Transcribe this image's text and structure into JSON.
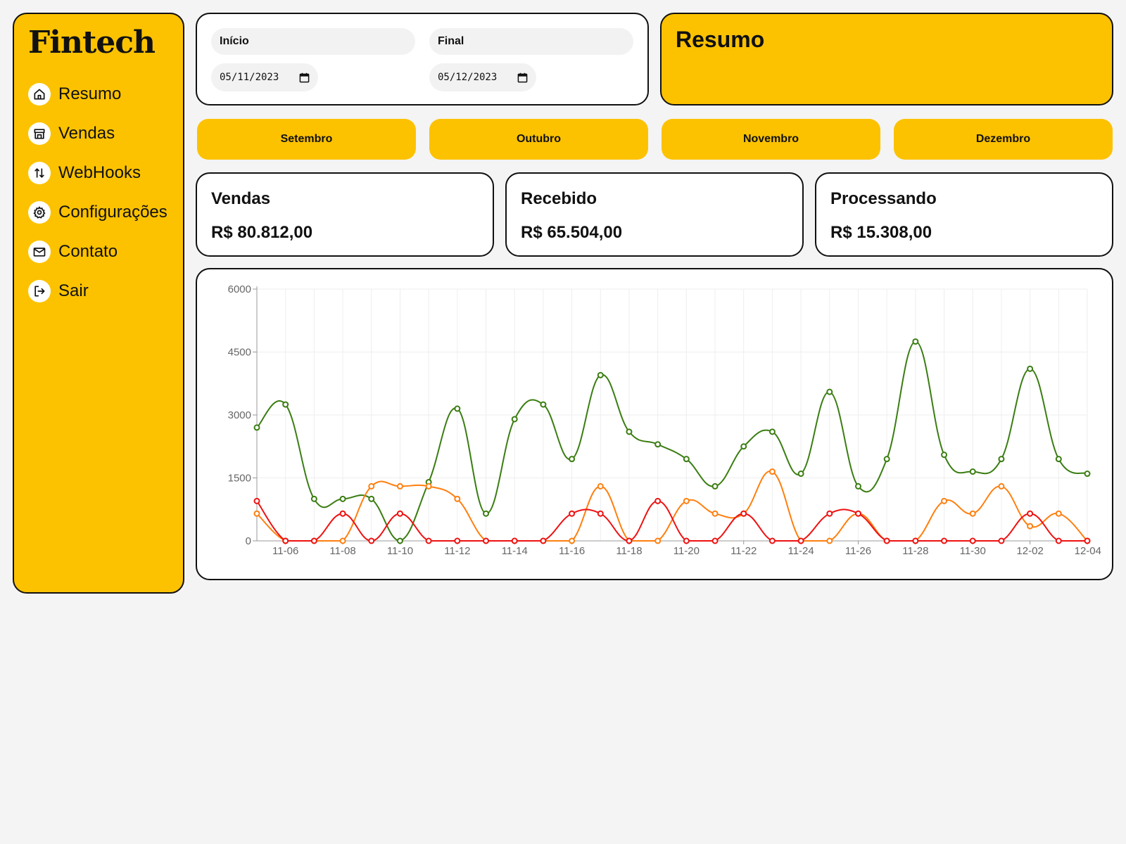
{
  "sidebar": {
    "logo": "Fintech",
    "items": [
      {
        "label": "Resumo",
        "icon": "home-icon"
      },
      {
        "label": "Vendas",
        "icon": "store-icon"
      },
      {
        "label": "WebHooks",
        "icon": "arrows-up-down-icon"
      },
      {
        "label": "Configurações",
        "icon": "gear-icon"
      },
      {
        "label": "Contato",
        "icon": "mail-icon"
      },
      {
        "label": "Sair",
        "icon": "logout-icon"
      }
    ]
  },
  "filters": {
    "start_label": "Início",
    "start_value": "05/11/2023",
    "end_label": "Final",
    "end_value": "05/12/2023"
  },
  "resumo": {
    "title": "Resumo"
  },
  "months": [
    "Setembro",
    "Outubro",
    "Novembro",
    "Dezembro"
  ],
  "metrics": [
    {
      "title": "Vendas",
      "value": "R$ 80.812,00"
    },
    {
      "title": "Recebido",
      "value": "R$ 65.504,00"
    },
    {
      "title": "Processando",
      "value": "R$ 15.308,00"
    }
  ],
  "colors": {
    "accent": "#fcc200",
    "series_green": "#3a7d12",
    "series_orange": "#ff7f0e",
    "series_red": "#ee1111"
  },
  "chart_data": {
    "type": "line",
    "title": "",
    "xlabel": "",
    "ylabel": "",
    "ylim": [
      0,
      6000
    ],
    "yticks": [
      0,
      1500,
      3000,
      4500,
      6000
    ],
    "x": [
      "11-05",
      "11-06",
      "11-07",
      "11-08",
      "11-09",
      "11-10",
      "11-11",
      "11-12",
      "11-13",
      "11-14",
      "11-15",
      "11-16",
      "11-17",
      "11-18",
      "11-19",
      "11-20",
      "11-21",
      "11-22",
      "11-23",
      "11-24",
      "11-25",
      "11-26",
      "11-27",
      "11-28",
      "11-29",
      "11-30",
      "12-01",
      "12-02",
      "12-03",
      "12-04"
    ],
    "xtick_labels": [
      "11-06",
      "11-08",
      "11-10",
      "11-12",
      "11-14",
      "11-16",
      "11-18",
      "11-20",
      "11-22",
      "11-24",
      "11-26",
      "11-28",
      "11-30",
      "12-02",
      "12-04"
    ],
    "grid": true,
    "legend": "none",
    "series": [
      {
        "color": "#3a7d12",
        "values": [
          2700,
          3250,
          1000,
          1000,
          1000,
          0,
          1400,
          3150,
          650,
          2900,
          3250,
          1950,
          3950,
          2600,
          2300,
          1950,
          1300,
          2250,
          2600,
          1600,
          3550,
          1300,
          1950,
          4750,
          2050,
          1650,
          1950,
          4100,
          1950,
          1600
        ]
      },
      {
        "color": "#ff7f0e",
        "values": [
          650,
          0,
          0,
          0,
          1300,
          1300,
          1300,
          1000,
          0,
          0,
          0,
          0,
          1300,
          0,
          0,
          950,
          650,
          650,
          1650,
          0,
          0,
          650,
          0,
          0,
          950,
          650,
          1300,
          350,
          650,
          0
        ]
      },
      {
        "color": "#ee1111",
        "values": [
          950,
          0,
          0,
          650,
          0,
          650,
          0,
          0,
          0,
          0,
          0,
          650,
          650,
          0,
          950,
          0,
          0,
          650,
          0,
          0,
          650,
          650,
          0,
          0,
          0,
          0,
          0,
          650,
          0,
          0
        ]
      }
    ]
  }
}
